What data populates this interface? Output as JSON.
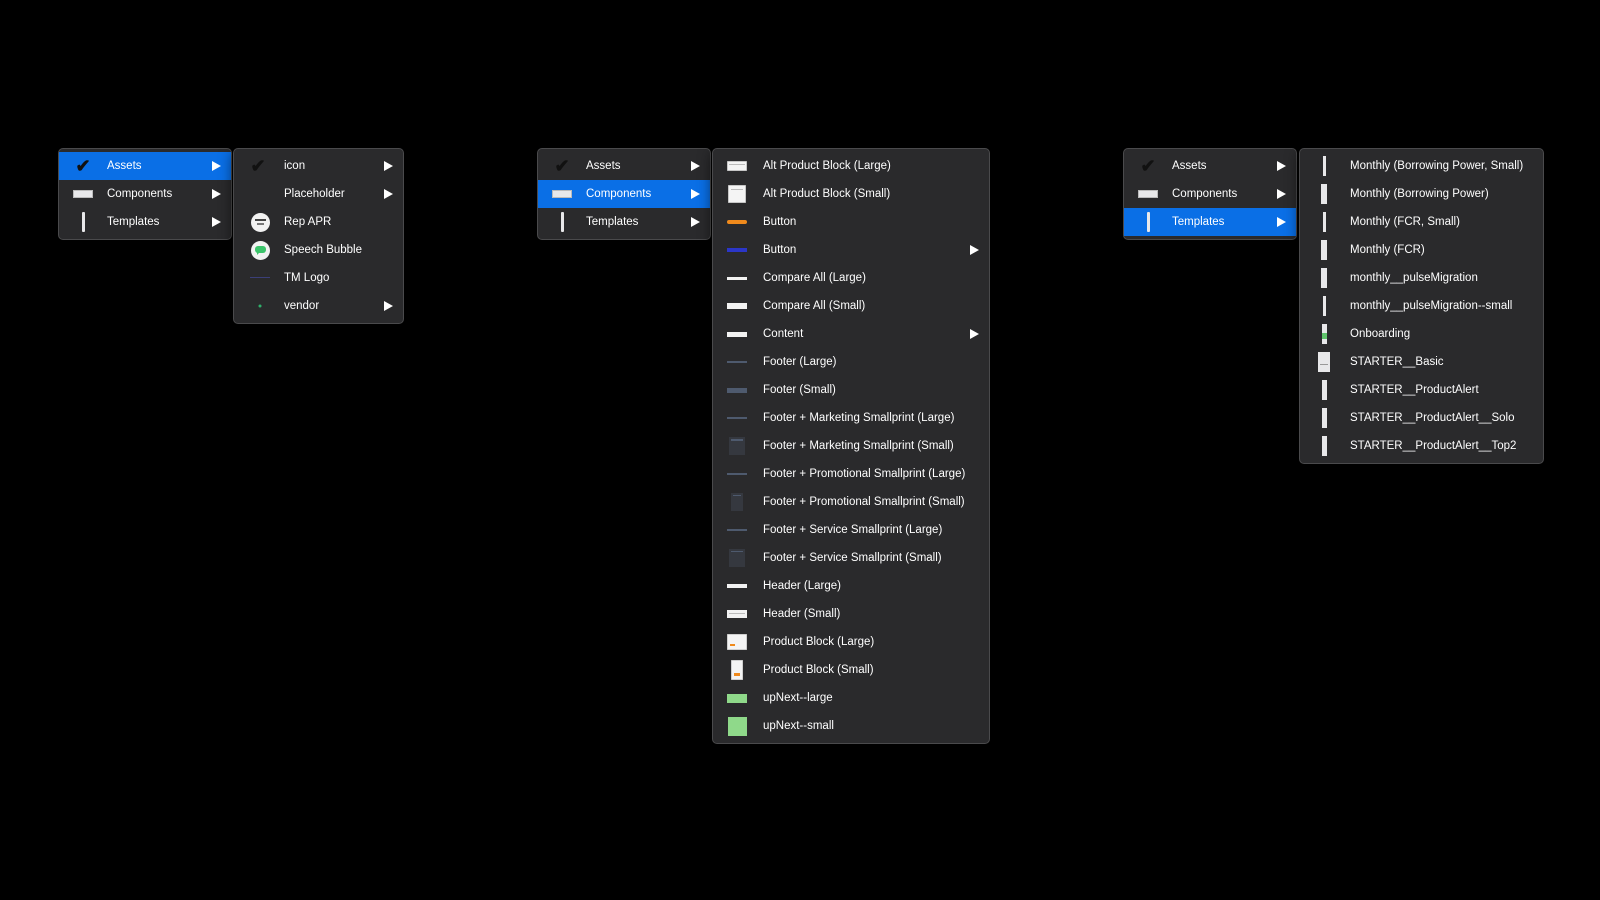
{
  "colors": {
    "menu_bg": "#2a2a2c",
    "selection": "#0a6fe6",
    "text": "#ffffff"
  },
  "group1": {
    "main": [
      {
        "label": "Assets",
        "icon": "checkmark-icon",
        "selected": true,
        "submenu": true
      },
      {
        "label": "Components",
        "icon": "component-thumbnail-icon",
        "selected": false,
        "submenu": true
      },
      {
        "label": "Templates",
        "icon": "template-thumbnail-icon",
        "selected": false,
        "submenu": true
      }
    ],
    "sub": [
      {
        "label": "icon",
        "icon": "checkmark-icon",
        "submenu": true
      },
      {
        "label": "Placeholder",
        "icon": "none",
        "submenu": true
      },
      {
        "label": "Rep APR",
        "icon": "rep-apr-badge-icon",
        "submenu": false
      },
      {
        "label": "Speech Bubble",
        "icon": "speech-bubble-icon",
        "submenu": false
      },
      {
        "label": "TM Logo",
        "icon": "tm-logo-icon",
        "submenu": false
      },
      {
        "label": "vendor",
        "icon": "vendor-icon",
        "submenu": true
      }
    ]
  },
  "group2": {
    "main": [
      {
        "label": "Assets",
        "icon": "checkmark-icon",
        "selected": false,
        "submenu": true
      },
      {
        "label": "Components",
        "icon": "component-thumbnail-icon",
        "selected": true,
        "submenu": true
      },
      {
        "label": "Templates",
        "icon": "template-thumbnail-icon",
        "selected": false,
        "submenu": true
      }
    ],
    "sub": [
      {
        "label": "Alt Product Block (Large)",
        "icon": "wide-white",
        "submenu": false
      },
      {
        "label": "Alt Product Block (Small)",
        "icon": "square-white",
        "submenu": false
      },
      {
        "label": "Button",
        "icon": "orange-bar",
        "submenu": false
      },
      {
        "label": "Button",
        "icon": "blue-bar",
        "submenu": true
      },
      {
        "label": "Compare All (Large)",
        "icon": "white-line",
        "submenu": false
      },
      {
        "label": "Compare All (Small)",
        "icon": "white-bar",
        "submenu": false
      },
      {
        "label": "Content",
        "icon": "white-bar",
        "submenu": true
      },
      {
        "label": "Footer (Large)",
        "icon": "slate-line",
        "submenu": false
      },
      {
        "label": "Footer (Small)",
        "icon": "slate-bar",
        "submenu": false
      },
      {
        "label": "Footer + Marketing Smallprint (Large)",
        "icon": "slate-line",
        "submenu": false
      },
      {
        "label": "Footer + Marketing Smallprint (Small)",
        "icon": "dark-square",
        "submenu": false
      },
      {
        "label": "Footer + Promotional Smallprint (Large)",
        "icon": "slate-line",
        "submenu": false
      },
      {
        "label": "Footer + Promotional Smallprint (Small)",
        "icon": "dark-tall",
        "submenu": false
      },
      {
        "label": "Footer + Service Smallprint (Large)",
        "icon": "slate-line",
        "submenu": false
      },
      {
        "label": "Footer + Service Smallprint (Small)",
        "icon": "dark-square",
        "submenu": false
      },
      {
        "label": "Header (Large)",
        "icon": "white-line",
        "submenu": false
      },
      {
        "label": "Header (Small)",
        "icon": "white-bar",
        "submenu": false
      },
      {
        "label": "Product Block (Large)",
        "icon": "product-large",
        "submenu": false
      },
      {
        "label": "Product Block (Small)",
        "icon": "product-small",
        "submenu": false
      },
      {
        "label": "upNext--large",
        "icon": "green-wide",
        "submenu": false
      },
      {
        "label": "upNext--small",
        "icon": "green-square",
        "submenu": false
      }
    ]
  },
  "group3": {
    "main": [
      {
        "label": "Assets",
        "icon": "checkmark-icon",
        "selected": false,
        "submenu": true
      },
      {
        "label": "Components",
        "icon": "component-thumbnail-icon",
        "selected": false,
        "submenu": true
      },
      {
        "label": "Templates",
        "icon": "template-thumbnail-icon",
        "selected": true,
        "submenu": true
      }
    ],
    "sub": [
      {
        "label": "Monthly (Borrowing Power, Small)",
        "icon": "tall-thin",
        "submenu": false
      },
      {
        "label": "Monthly (Borrowing Power)",
        "icon": "tall",
        "submenu": false
      },
      {
        "label": "Monthly (FCR, Small)",
        "icon": "tall-thin",
        "submenu": false
      },
      {
        "label": "Monthly (FCR)",
        "icon": "tall",
        "submenu": false
      },
      {
        "label": "monthly__pulseMigration",
        "icon": "tall",
        "submenu": false
      },
      {
        "label": "monthly__pulseMigration--small",
        "icon": "tall-thin",
        "submenu": false
      },
      {
        "label": "Onboarding",
        "icon": "tall-green",
        "submenu": false
      },
      {
        "label": "STARTER__Basic",
        "icon": "tall-wide",
        "submenu": false
      },
      {
        "label": "STARTER__ProductAlert",
        "icon": "tall",
        "submenu": false
      },
      {
        "label": "STARTER__ProductAlert__Solo",
        "icon": "tall",
        "submenu": false
      },
      {
        "label": "STARTER__ProductAlert__Top2",
        "icon": "tall",
        "submenu": false
      }
    ]
  }
}
